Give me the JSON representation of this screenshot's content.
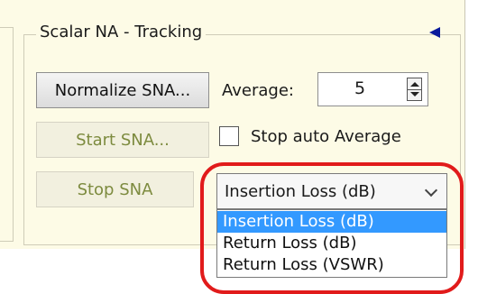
{
  "panel": {
    "title": "Scalar NA - Tracking",
    "collapse_icon": "left-arrow-icon"
  },
  "buttons": {
    "normalize": "Normalize SNA...",
    "start": "Start SNA...",
    "stop": "Stop SNA"
  },
  "average": {
    "label": "Average:",
    "value": "5"
  },
  "checkbox": {
    "label": "Stop auto Average",
    "checked": false
  },
  "measurement_select": {
    "selected": "Insertion Loss (dB)",
    "options": [
      "Insertion Loss (dB)",
      "Return Loss (dB)",
      "Return Loss (VSWR)"
    ],
    "highlighted_index": 0
  },
  "colors": {
    "panel_background": "#fdfbe6",
    "highlight_ring": "#e11b1b",
    "selection": "#3399ff",
    "disabled_text": "#7d8b3f",
    "arrow": "#0a1a9c"
  }
}
